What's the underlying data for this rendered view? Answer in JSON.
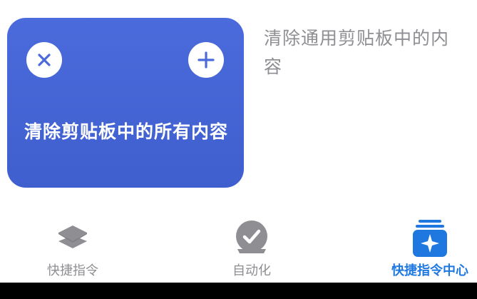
{
  "card": {
    "title": "清除剪贴板中的所有内容",
    "background": "#4b6bdc",
    "close_icon": "close-icon",
    "add_icon": "plus-icon"
  },
  "description": "清除通用剪贴板中的内容",
  "tabs": [
    {
      "label": "快捷指令",
      "icon": "layers-icon",
      "selected": false
    },
    {
      "label": "自动化",
      "icon": "clock-check-icon",
      "selected": false
    },
    {
      "label": "快捷指令中心",
      "icon": "sparkle-stack-icon",
      "selected": true
    }
  ],
  "colors": {
    "accent": "#1f78e0",
    "inactive": "#8e8e93",
    "icon_gray": "#8e8e93"
  }
}
